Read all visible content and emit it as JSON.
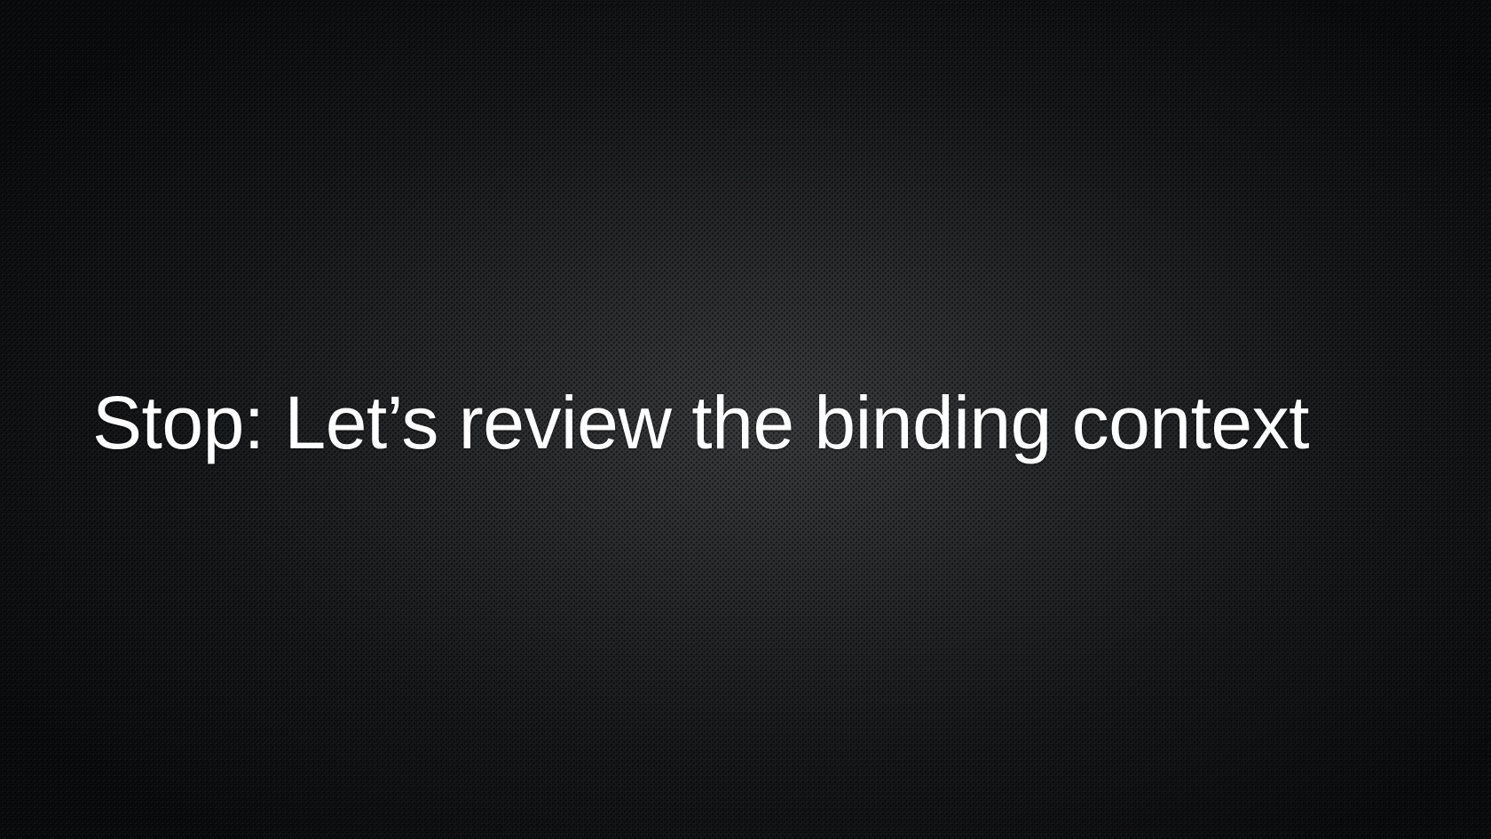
{
  "slide": {
    "title": "Stop: Let’s review the binding context"
  },
  "colors": {
    "background_center": "#3a3b3d",
    "background_edge": "#0b0c0e",
    "text": "#ffffff"
  }
}
